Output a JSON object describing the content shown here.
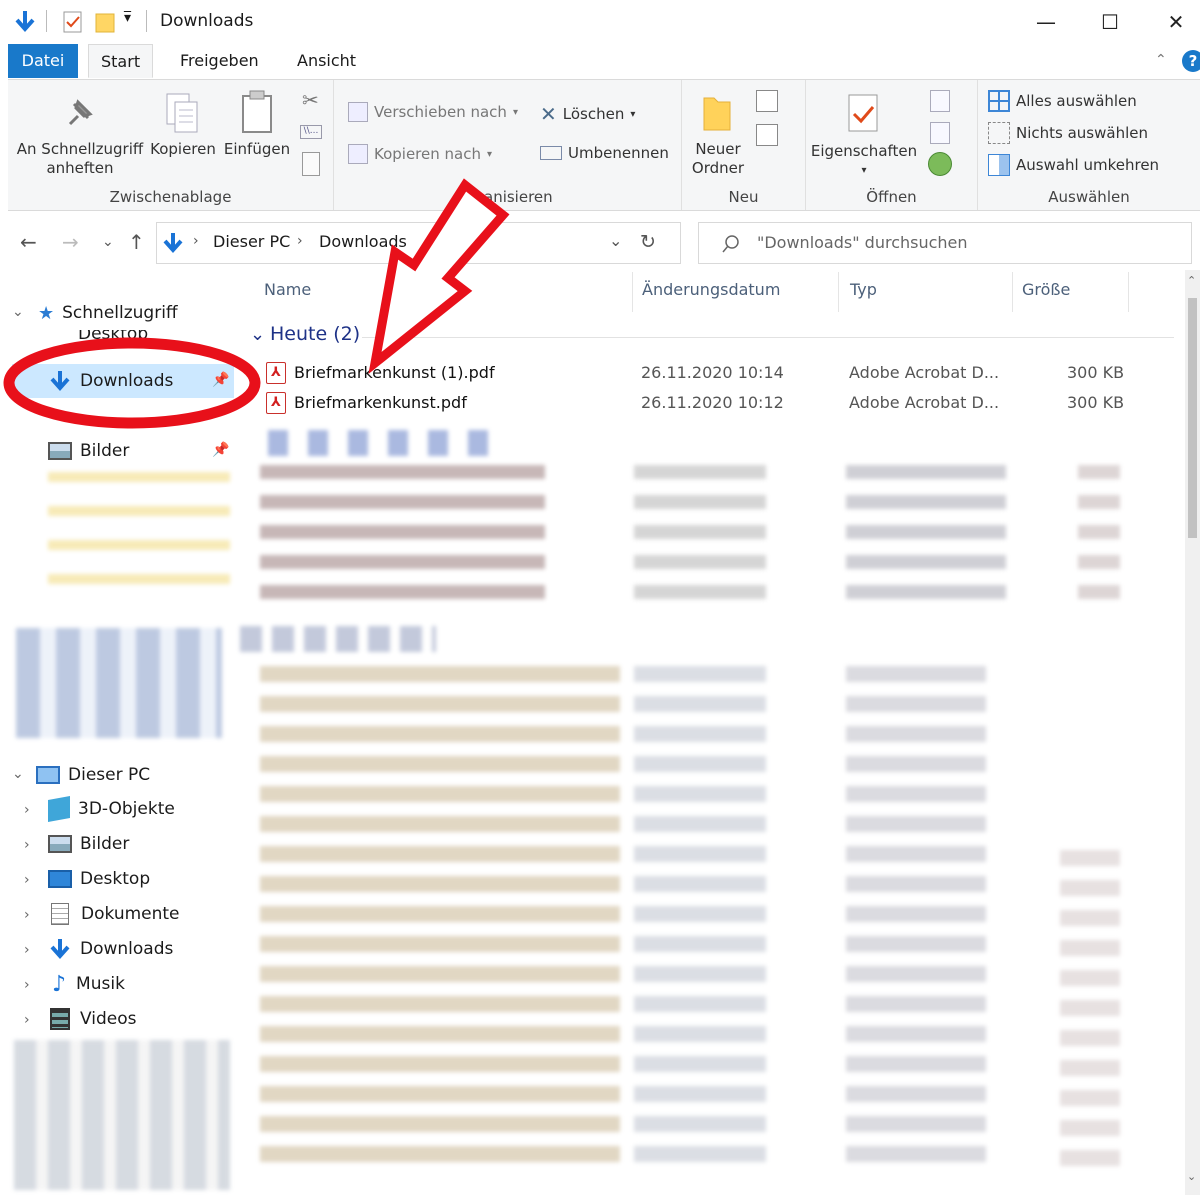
{
  "window": {
    "title": "Downloads",
    "controls": {
      "minimize": "—",
      "maximize": "☐",
      "close": "✕"
    }
  },
  "tabs": [
    {
      "label": "Datei"
    },
    {
      "label": "Start"
    },
    {
      "label": "Freigeben"
    },
    {
      "label": "Ansicht"
    }
  ],
  "ribbon": {
    "clipboard": {
      "pin_label_1": "An Schnellzugriff",
      "pin_label_2": "anheften",
      "copy_label": "Kopieren",
      "paste_label": "Einfügen",
      "group_label": "Zwischenablage"
    },
    "organize": {
      "move_to": "Verschieben nach",
      "copy_to": "Kopieren nach",
      "delete": "Löschen",
      "rename": "Umbenennen",
      "group_label": "anisieren"
    },
    "new": {
      "new_folder_1": "Neuer",
      "new_folder_2": "Ordner",
      "group_label": "Neu"
    },
    "open": {
      "properties": "Eigenschaften",
      "group_label": "Öffnen"
    },
    "select": {
      "select_all": "Alles auswählen",
      "select_none": "Nichts auswählen",
      "invert": "Auswahl umkehren",
      "group_label": "Auswählen"
    }
  },
  "address": {
    "crumbs": [
      "Dieser PC",
      "Downloads"
    ],
    "search_placeholder": "\"Downloads\" durchsuchen"
  },
  "nav": {
    "quick_access": "Schnellzugriff",
    "desktop": "Desktop",
    "downloads": "Downloads",
    "pictures": "Bilder",
    "this_pc": "Dieser PC",
    "pc_items": [
      "3D-Objekte",
      "Bilder",
      "Desktop",
      "Dokumente",
      "Downloads",
      "Musik",
      "Videos"
    ]
  },
  "columns": {
    "name": "Name",
    "date": "Änderungsdatum",
    "type": "Typ",
    "size": "Größe"
  },
  "group": {
    "label": "Heute (2)"
  },
  "files": [
    {
      "name": "Briefmarkenkunst (1).pdf",
      "date": "26.11.2020 10:14",
      "type": "Adobe Acrobat D...",
      "size": "300 KB"
    },
    {
      "name": "Briefmarkenkunst.pdf",
      "date": "26.11.2020 10:12",
      "type": "Adobe Acrobat D...",
      "size": "300 KB"
    }
  ],
  "annotation_colors": {
    "marker": "#e8101a"
  }
}
